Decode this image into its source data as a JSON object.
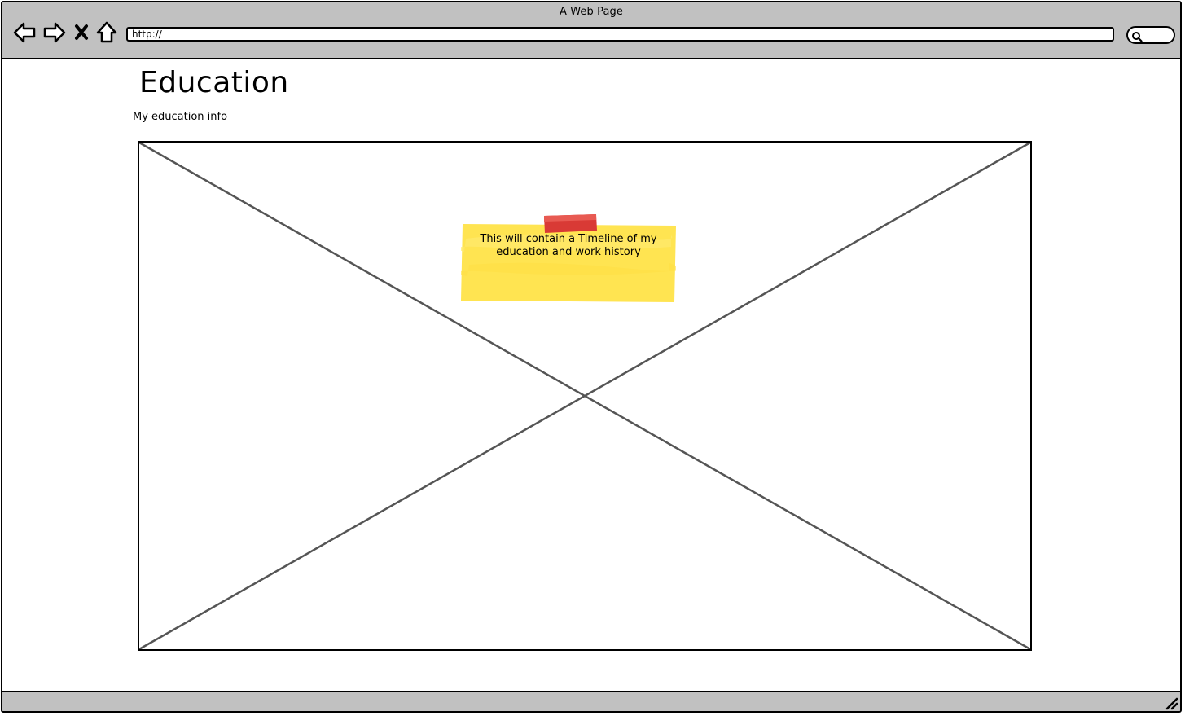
{
  "window": {
    "title": "A Web Page"
  },
  "toolbar": {
    "back_icon": "back-arrow-icon",
    "forward_icon": "forward-arrow-icon",
    "stop_icon": "close-x-icon",
    "home_icon": "home-icon",
    "search_icon": "search-icon"
  },
  "address_bar": {
    "value": "http://"
  },
  "page": {
    "title": "Education",
    "subtitle": "My education info"
  },
  "placeholder": {
    "icon": "image-placeholder-cross"
  },
  "sticky_note": {
    "text": "This will contain a Timeline of my education and work history",
    "note_color": "#ffe451",
    "tape_color": "#d93a35"
  },
  "colors": {
    "chrome": "#c1c1c1",
    "border": "#000000",
    "placeholder_lines": "#555555"
  }
}
